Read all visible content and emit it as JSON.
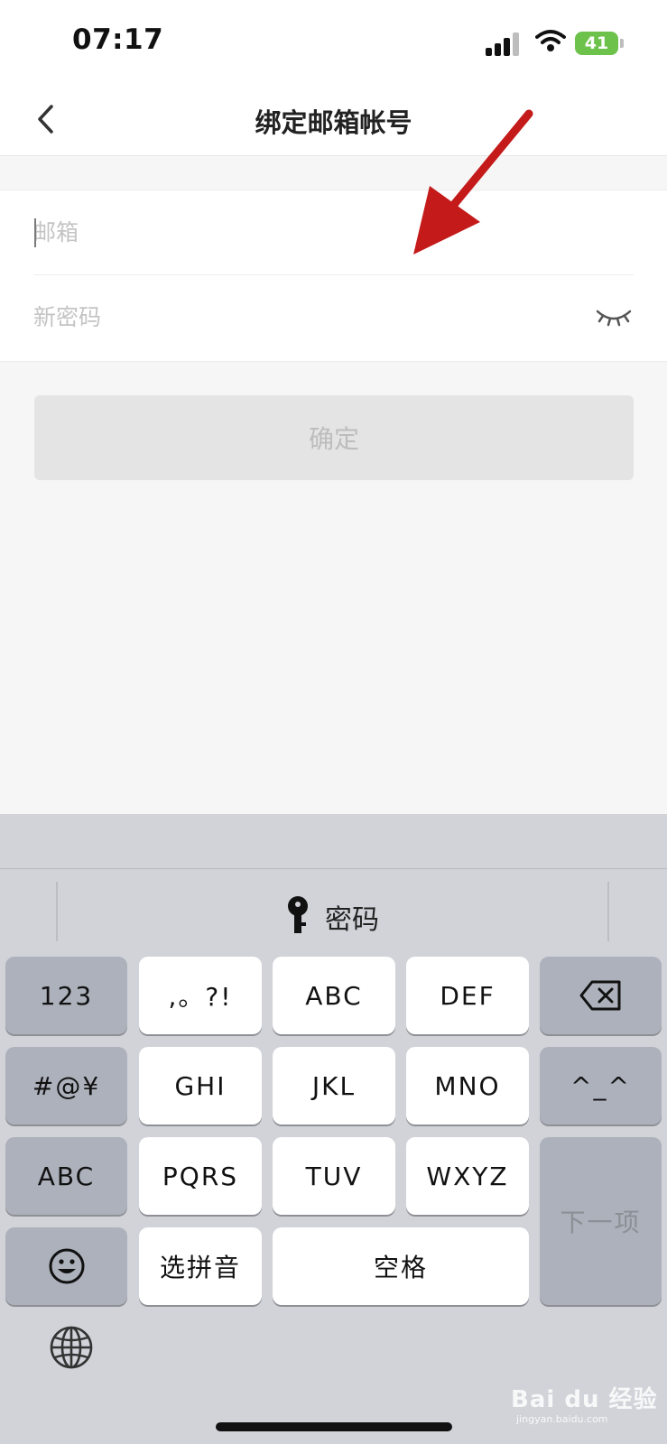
{
  "status_bar": {
    "time": "07:17",
    "battery": "41"
  },
  "nav": {
    "title": "绑定邮箱帐号"
  },
  "form": {
    "email_placeholder": "邮箱",
    "password_placeholder": "新密码",
    "confirm_label": "确定"
  },
  "keyboard": {
    "suggestion": "密码",
    "rows": [
      [
        "123",
        ",。?!",
        "ABC",
        "DEF"
      ],
      [
        "#@¥",
        "GHI",
        "JKL",
        "MNO",
        "^_^"
      ],
      [
        "ABC",
        "PQRS",
        "TUV",
        "WXYZ",
        "下一项"
      ],
      [
        "选拼音",
        "空格"
      ]
    ]
  },
  "watermark": {
    "brand": "Bai du 经验",
    "url": "jingyan.baidu.com"
  },
  "colors": {
    "annotation_arrow": "#c41a1a",
    "battery": "#6cc24a",
    "keyboard_bg": "#d1d3d9"
  }
}
